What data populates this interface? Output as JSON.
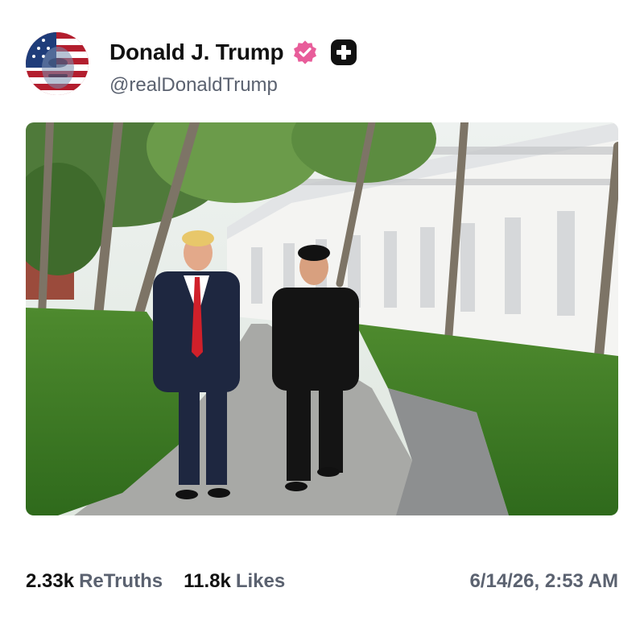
{
  "author": {
    "display_name": "Donald J. Trump",
    "handle": "@realDonaldTrump"
  },
  "stats": {
    "retruths_count": "2.33k",
    "retruths_label": "ReTruths",
    "likes_count": "11.8k",
    "likes_label": "Likes"
  },
  "timestamp": "6/14/26, 2:53 AM",
  "colors": {
    "verified_badge": "#e85d9a",
    "plus_badge": "#111111",
    "secondary_text": "#5b6270"
  },
  "icons": {
    "verified": "verified-check-icon",
    "plus": "plus-badge-icon"
  }
}
